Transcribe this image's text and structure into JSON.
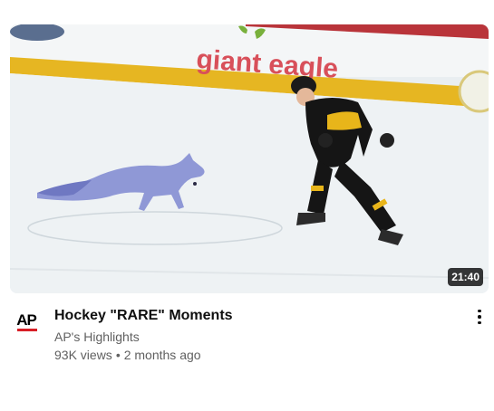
{
  "video": {
    "duration": "21:40",
    "title": "Hockey \"RARE\" Moments",
    "channel": "AP's Highlights",
    "views": "93K views",
    "separator": "•",
    "age": "2 months ago",
    "channel_logo_text": "AP",
    "thumbnail_banner_text": "giant eagle"
  },
  "icons": {
    "menu": "more-vert-icon"
  },
  "colors": {
    "title_text": "#0f0f0f",
    "secondary_text": "#606060",
    "duration_badge": "#000000",
    "logo_red": "#d81f26"
  }
}
